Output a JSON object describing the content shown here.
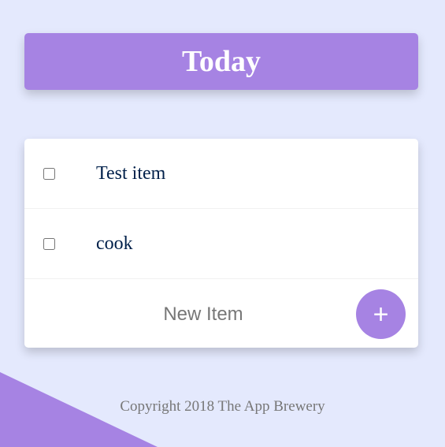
{
  "heading": {
    "title": "Today"
  },
  "items": [
    {
      "label": "Test item",
      "checked": false
    },
    {
      "label": "cook",
      "checked": false
    }
  ],
  "new_item": {
    "value": "",
    "placeholder": "New Item",
    "add_button_label": "+"
  },
  "footer": {
    "copyright": "Copyright 2018 The App Brewery"
  },
  "colors": {
    "background": "#E4E9FD",
    "accent": "#A683E3",
    "item_text": "#00204A"
  }
}
